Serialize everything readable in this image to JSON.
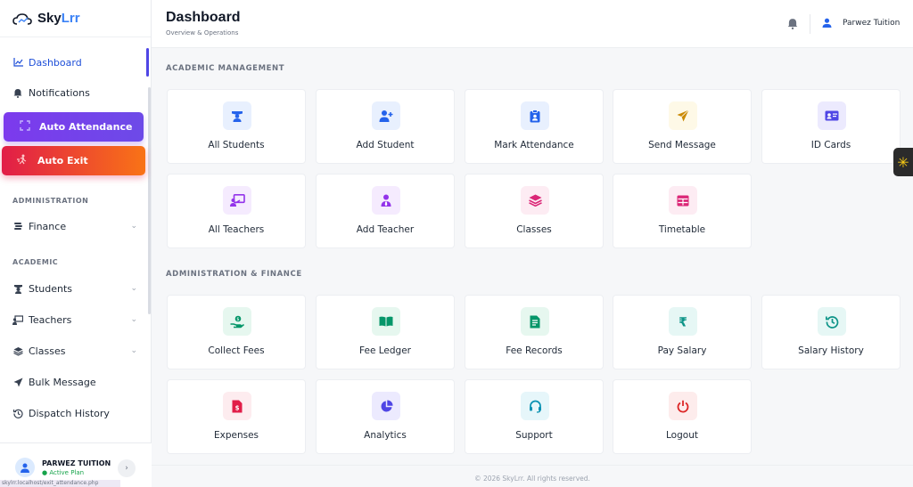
{
  "brand": {
    "name_part1": "Sky",
    "name_part2": "Lrr"
  },
  "sidebar": {
    "nav_top": [
      {
        "label": "Dashboard",
        "icon": "chart-line-icon"
      },
      {
        "label": "Notifications",
        "icon": "bell-icon"
      }
    ],
    "auto_attendance": "Auto Attendance",
    "auto_exit": "Auto Exit",
    "section_admin": "ADMINISTRATION",
    "finance": "Finance",
    "section_academic": "ACADEMIC",
    "students": "Students",
    "teachers": "Teachers",
    "classes": "Classes",
    "bulk_message": "Bulk Message",
    "dispatch_history": "Dispatch History",
    "user": {
      "name": "PARWEZ TUITION",
      "plan": "● Active Plan"
    },
    "status_url": "skylrr.localhost/exit_attendance.php"
  },
  "header": {
    "title": "Dashboard",
    "subtitle": "Overview & Operations",
    "user_name": "Parwez Tuition"
  },
  "sections": {
    "academic": "ACADEMIC MANAGEMENT",
    "admin": "ADMINISTRATION & FINANCE"
  },
  "cards_academic": [
    {
      "label": "All Students",
      "icon": "graduate-icon",
      "color": "#2563eb",
      "bg": "#e8f0fe"
    },
    {
      "label": "Add Student",
      "icon": "user-plus-icon",
      "color": "#2563eb",
      "bg": "#e8f0fe"
    },
    {
      "label": "Mark Attendance",
      "icon": "clipboard-user-icon",
      "color": "#2563eb",
      "bg": "#e8f0fe"
    },
    {
      "label": "Send Message",
      "icon": "paper-plane-icon",
      "color": "#ca8a04",
      "bg": "#fef9e7"
    },
    {
      "label": "ID Cards",
      "icon": "id-card-icon",
      "color": "#4f46e5",
      "bg": "#eceafe"
    },
    {
      "label": "All Teachers",
      "icon": "chalkboard-teacher-icon",
      "color": "#9333ea",
      "bg": "#f5ebfe"
    },
    {
      "label": "Add Teacher",
      "icon": "user-tie-icon",
      "color": "#9333ea",
      "bg": "#f5ebfe"
    },
    {
      "label": "Classes",
      "icon": "layers-icon",
      "color": "#db2777",
      "bg": "#fdecf3"
    },
    {
      "label": "Timetable",
      "icon": "table-icon",
      "color": "#db2777",
      "bg": "#fdecf3"
    }
  ],
  "cards_admin": [
    {
      "label": "Collect Fees",
      "icon": "hand-coin-icon",
      "color": "#059669",
      "bg": "#e6f7ef"
    },
    {
      "label": "Fee Ledger",
      "icon": "book-open-icon",
      "color": "#059669",
      "bg": "#e6f7ef"
    },
    {
      "label": "Fee Records",
      "icon": "file-invoice-icon",
      "color": "#059669",
      "bg": "#e6f7ef"
    },
    {
      "label": "Pay Salary",
      "icon": "rupee-icon",
      "color": "#0d9488",
      "bg": "#e6f7f5"
    },
    {
      "label": "Salary History",
      "icon": "history-icon",
      "color": "#0d9488",
      "bg": "#e6f7f5"
    },
    {
      "label": "Expenses",
      "icon": "receipt-dollar-icon",
      "color": "#e11d48",
      "bg": "#fdecef"
    },
    {
      "label": "Analytics",
      "icon": "pie-chart-icon",
      "color": "#4f46e5",
      "bg": "#eceafe"
    },
    {
      "label": "Support",
      "icon": "headset-icon",
      "color": "#0891b2",
      "bg": "#e6f6fa"
    },
    {
      "label": "Logout",
      "icon": "power-icon",
      "color": "#dc2626",
      "bg": "#fdecec"
    }
  ],
  "footer": "© 2026 SkyLrr. All rights reserved."
}
